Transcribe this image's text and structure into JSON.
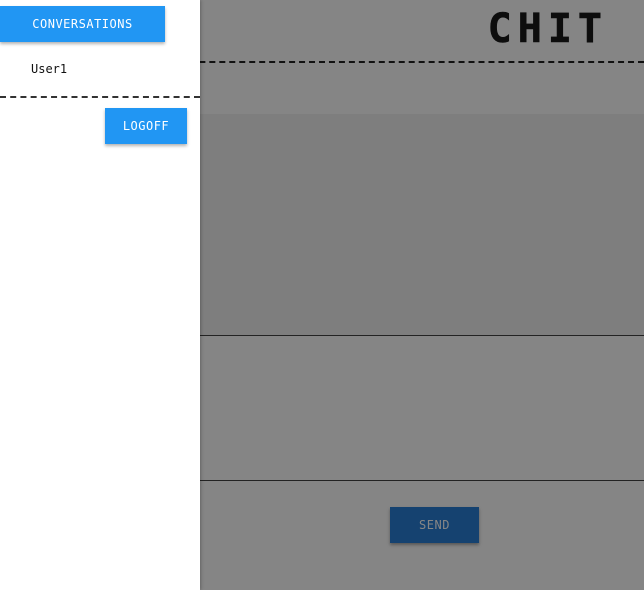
{
  "app": {
    "title": "CHIT",
    "send_label": "SEND"
  },
  "drawer": {
    "conversations_label": "CONVERSATIONS",
    "users": [
      {
        "label": "User1"
      }
    ],
    "logoff_label": "LOGOFF"
  },
  "colors": {
    "primary": "#2196f3",
    "overlay": "rgba(0,0,0,0.48)",
    "drawer_background": "#ffffff"
  }
}
